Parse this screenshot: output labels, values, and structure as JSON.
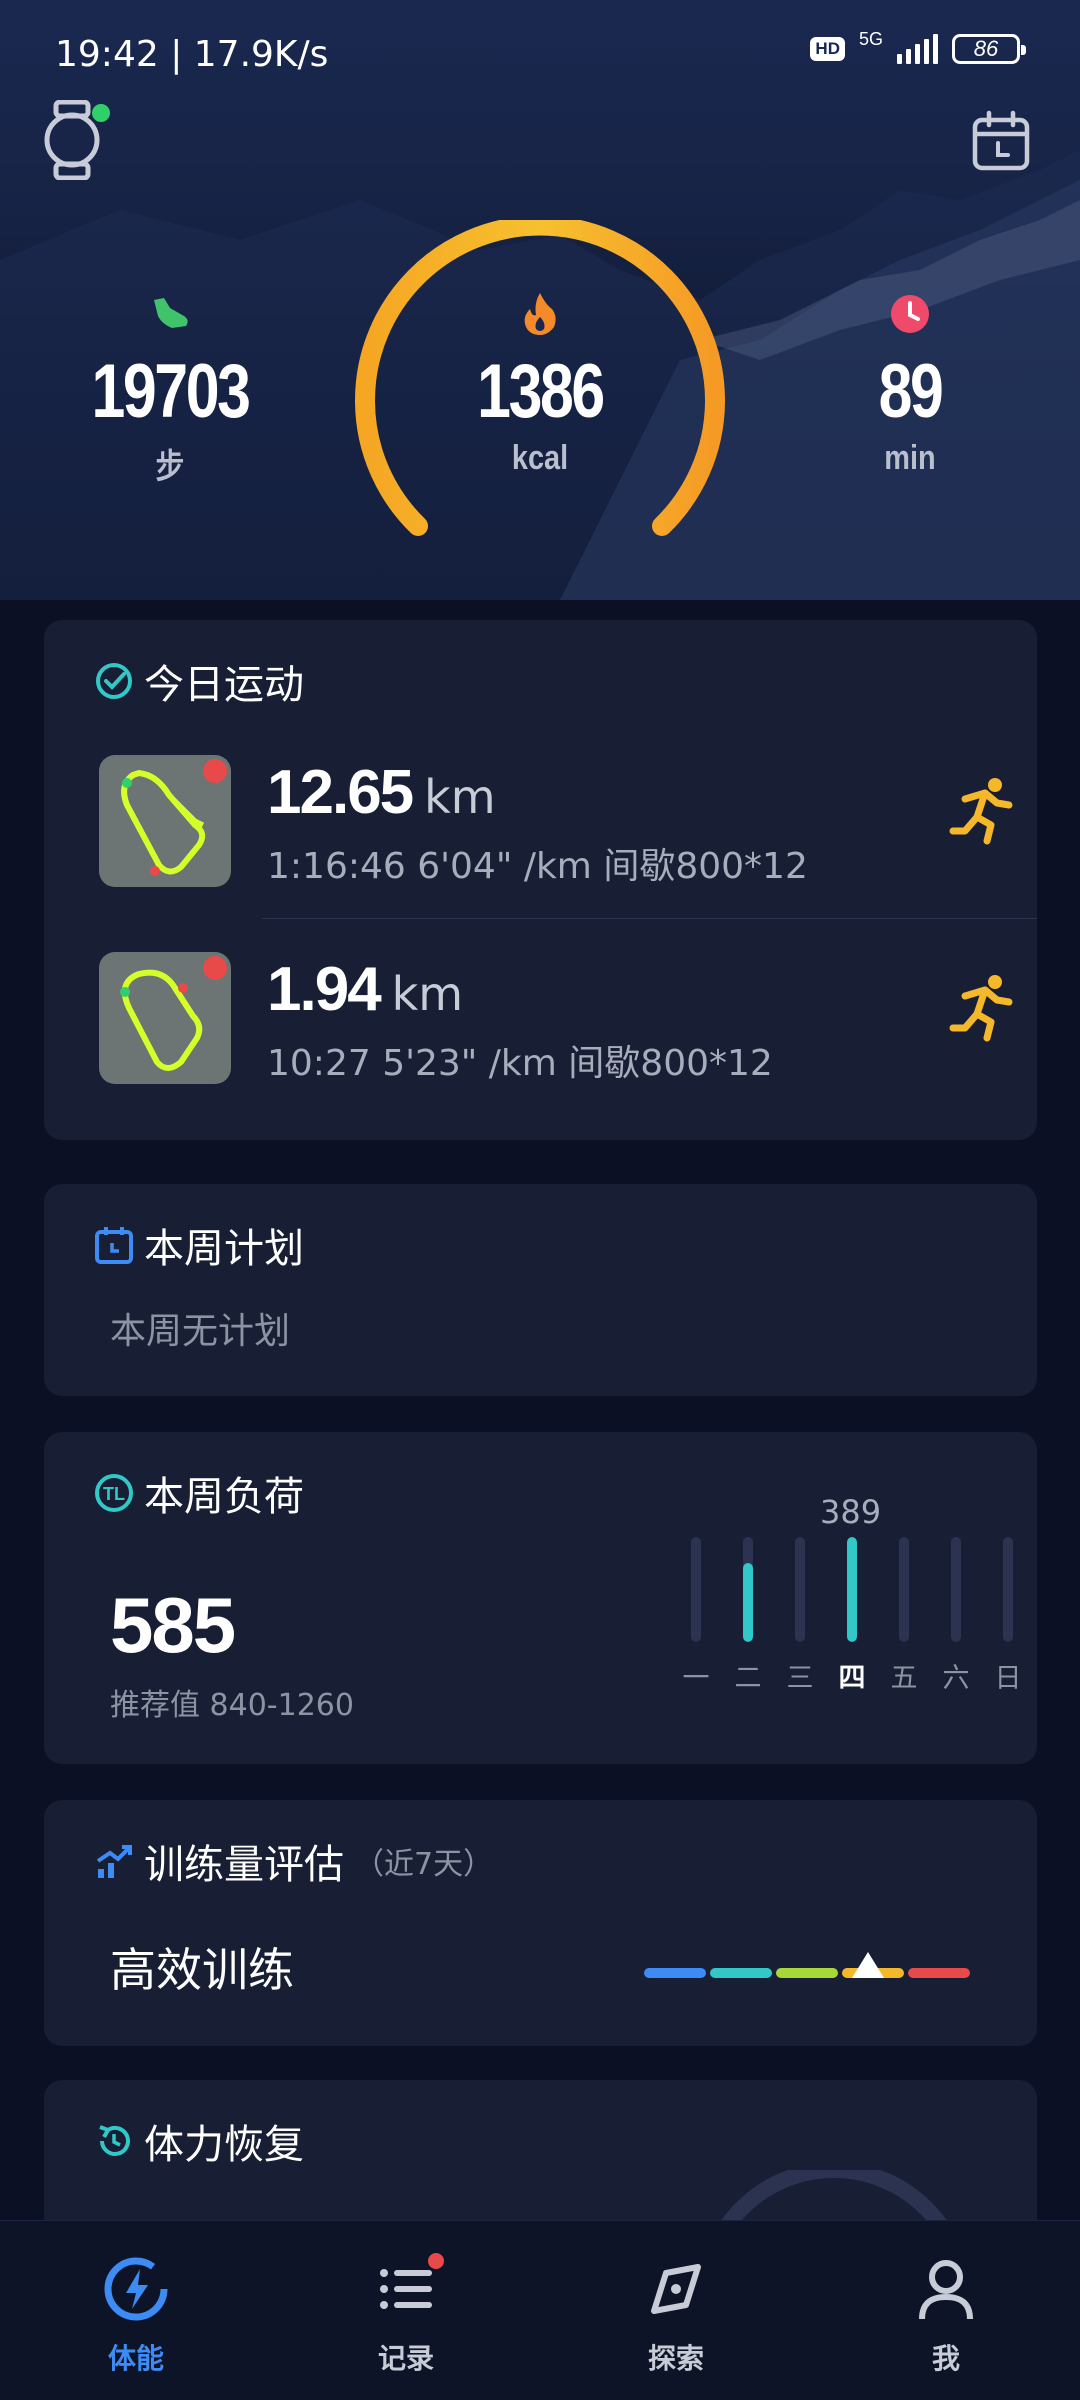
{
  "status_bar": {
    "time": "19:42 | 17.9K/s",
    "hd": "HD",
    "network": "5G",
    "battery": "86"
  },
  "summary": {
    "steps": {
      "value": "19703",
      "unit": "步",
      "icon": "shoe-icon",
      "color": "#3fc46b"
    },
    "calories": {
      "value": "1386",
      "unit": "kcal",
      "icon": "flame-icon",
      "color": "#f58a2a"
    },
    "minutes": {
      "value": "89",
      "unit": "min",
      "icon": "clock-icon",
      "color": "#f04a6a"
    },
    "gauge_color_start": "#f5a623",
    "gauge_color_end": "#f7c82f"
  },
  "today_workouts": {
    "title": "今日运动",
    "items": [
      {
        "distance": "12.65",
        "unit": "km",
        "meta": "1:16:46  6'04\" /km  间歇800*12",
        "icon": "running-icon"
      },
      {
        "distance": "1.94",
        "unit": "km",
        "meta": "10:27  5'23\" /km  间歇800*12",
        "icon": "running-icon"
      }
    ]
  },
  "weekly_plan": {
    "title": "本周计划",
    "empty_text": "本周无计划"
  },
  "weekly_load": {
    "title": "本周负荷",
    "value": "585",
    "recommended": "推荐值 840-1260",
    "peak_label": "389",
    "days": [
      {
        "label": "一",
        "value": 0
      },
      {
        "label": "二",
        "value": 0.75
      },
      {
        "label": "三",
        "value": 0
      },
      {
        "label": "四",
        "value": 1.0,
        "today": true
      },
      {
        "label": "五",
        "value": 0
      },
      {
        "label": "六",
        "value": 0
      },
      {
        "label": "日",
        "value": 0
      }
    ],
    "accent": "#32c8c8"
  },
  "training_eval": {
    "title": "训练量评估",
    "period": "（近7天）",
    "result": "高效训练",
    "scale_colors": [
      "#3d8bf5",
      "#32c8c8",
      "#a6d83a",
      "#f5b82a",
      "#e84a4a"
    ],
    "marker_position": 0.68
  },
  "recovery": {
    "title": "体力恢复"
  },
  "tabbar": {
    "tabs": [
      {
        "label": "体能",
        "icon": "lightning-icon",
        "active": true
      },
      {
        "label": "记录",
        "icon": "list-icon",
        "badge": true
      },
      {
        "label": "探索",
        "icon": "compass-icon"
      },
      {
        "label": "我",
        "icon": "profile-icon"
      }
    ]
  }
}
